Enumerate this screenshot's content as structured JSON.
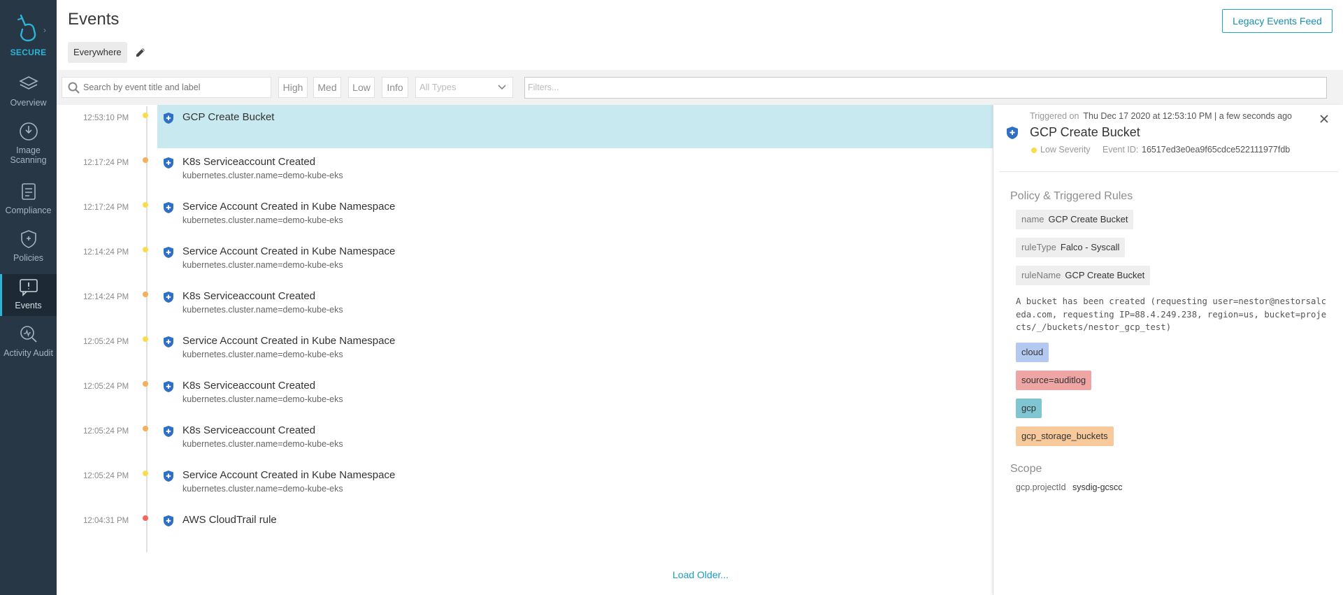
{
  "sidebar": {
    "brand": "SECURE",
    "items": [
      {
        "label": "Overview",
        "icon": "layers-icon"
      },
      {
        "label": "Image Scanning",
        "icon": "scan-icon"
      },
      {
        "label": "Compliance",
        "icon": "clipboard-icon"
      },
      {
        "label": "Policies",
        "icon": "shield-icon"
      },
      {
        "label": "Events",
        "icon": "events-icon",
        "active": true
      },
      {
        "label": "Activity Audit",
        "icon": "audit-icon"
      }
    ]
  },
  "header": {
    "title": "Events",
    "legacy_button": "Legacy Events Feed",
    "scope": "Everywhere"
  },
  "filters": {
    "search_placeholder": "Search by event title and label",
    "severity": [
      "High",
      "Med",
      "Low",
      "Info"
    ],
    "type_select": "All Types",
    "filters_placeholder": "Filters..."
  },
  "events": [
    {
      "time": "12:53:10 PM",
      "title": "GCP Create Bucket",
      "sub": "",
      "severity": "low",
      "selected": true
    },
    {
      "time": "12:17:24 PM",
      "title": "K8s Serviceaccount Created",
      "sub": "kubernetes.cluster.name=demo-kube-eks",
      "severity": "medium"
    },
    {
      "time": "12:17:24 PM",
      "title": "Service Account Created in Kube Namespace",
      "sub": "kubernetes.cluster.name=demo-kube-eks",
      "severity": "low"
    },
    {
      "time": "12:14:24 PM",
      "title": "Service Account Created in Kube Namespace",
      "sub": "kubernetes.cluster.name=demo-kube-eks",
      "severity": "low"
    },
    {
      "time": "12:14:24 PM",
      "title": "K8s Serviceaccount Created",
      "sub": "kubernetes.cluster.name=demo-kube-eks",
      "severity": "medium"
    },
    {
      "time": "12:05:24 PM",
      "title": "Service Account Created in Kube Namespace",
      "sub": "kubernetes.cluster.name=demo-kube-eks",
      "severity": "low"
    },
    {
      "time": "12:05:24 PM",
      "title": "K8s Serviceaccount Created",
      "sub": "kubernetes.cluster.name=demo-kube-eks",
      "severity": "medium"
    },
    {
      "time": "12:05:24 PM",
      "title": "K8s Serviceaccount Created",
      "sub": "kubernetes.cluster.name=demo-kube-eks",
      "severity": "medium"
    },
    {
      "time": "12:05:24 PM",
      "title": "Service Account Created in Kube Namespace",
      "sub": "kubernetes.cluster.name=demo-kube-eks",
      "severity": "low"
    },
    {
      "time": "12:04:31 PM",
      "title": "AWS CloudTrail rule",
      "sub": "",
      "severity": "high"
    }
  ],
  "severity_colors": {
    "high": "#f2685e",
    "medium": "#f6ae5b",
    "low": "#f8dc4e"
  },
  "load_older": "Load Older...",
  "detail": {
    "triggered_label": "Triggered on",
    "triggered_value": "Thu Dec 17 2020 at 12:53:10 PM | a few seconds ago",
    "title": "GCP Create Bucket",
    "severity": "Low Severity",
    "event_id_label": "Event ID:",
    "event_id": "16517ed3e0ea9f65cdce522111977fdb",
    "policy_heading": "Policy & Triggered Rules",
    "rules": [
      {
        "key": "name",
        "value": "GCP Create Bucket"
      },
      {
        "key": "ruleType",
        "value": "Falco - Syscall"
      },
      {
        "key": "ruleName",
        "value": "GCP Create Bucket"
      }
    ],
    "description": "A bucket has been created (requesting user=nestor@nestorsalceda.com, requesting IP=88.4.249.238, region=us, bucket=projects/_/buckets/nestor_gcp_test)",
    "tags": [
      {
        "label": "cloud",
        "color": "#b3c9f2"
      },
      {
        "label": "source=auditlog",
        "color": "#f0a5a5"
      },
      {
        "label": "gcp",
        "color": "#7fc6d2"
      },
      {
        "label": "gcp_storage_buckets",
        "color": "#f8c99a"
      }
    ],
    "scope_heading": "Scope",
    "scope_key": "gcp.projectId",
    "scope_value": "sysdig-gcscc"
  }
}
